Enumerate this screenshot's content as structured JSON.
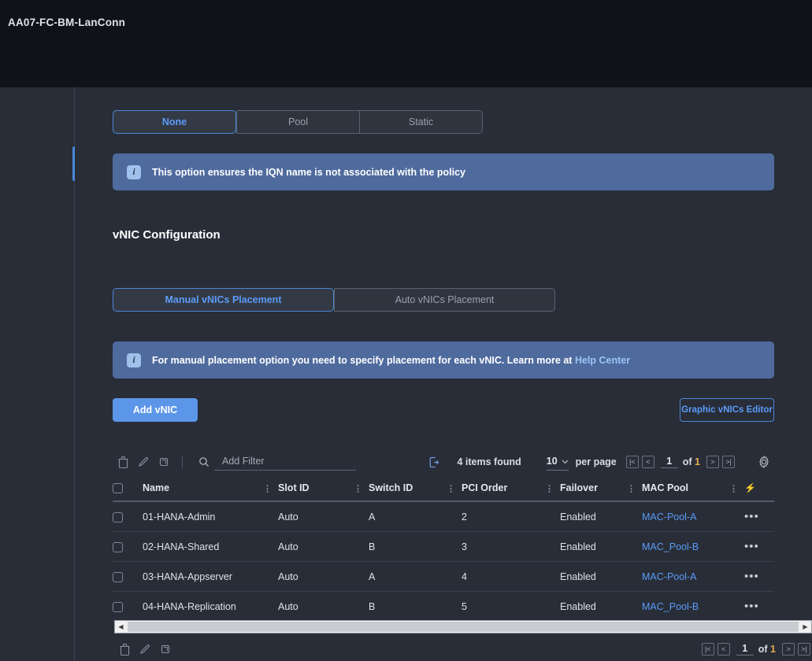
{
  "window": {
    "title": "AA07-FC-BM-LanConn"
  },
  "iqn_section": {
    "options": [
      {
        "label": "None",
        "active": true
      },
      {
        "label": "Pool",
        "active": false
      },
      {
        "label": "Static",
        "active": false
      }
    ],
    "banner": {
      "icon": "info-icon",
      "text": "This option ensures the IQN name is not associated with the policy"
    }
  },
  "vnic_section": {
    "heading": "vNIC Configuration",
    "placement_options": [
      {
        "label": "Manual vNICs Placement",
        "active": true
      },
      {
        "label": "Auto vNICs Placement",
        "active": false
      }
    ],
    "banner": {
      "icon": "info-icon",
      "text": "For manual placement option you need to specify placement for each vNIC. Learn more at ",
      "link": "Help Center"
    },
    "add_button": "Add vNIC",
    "graphic_editor_button": "Graphic vNICs Editor"
  },
  "toolbar": {
    "delete_icon": "trash-icon",
    "edit_icon": "pencil-icon",
    "clone_icon": "clone-icon",
    "search_icon": "search-icon",
    "filter_placeholder": "Add Filter",
    "filter_value": "",
    "refresh_icon": "refresh-icon",
    "items_found": "4 items found",
    "per_page_value": "10",
    "per_page_label": "per page",
    "page_number": "1",
    "page_total_prefix": "of ",
    "page_total": "1",
    "settings_icon": "gear-icon",
    "first_page_icon": "|<",
    "prev_page_icon": "<",
    "next_page_icon": ">",
    "last_page_icon": ">|"
  },
  "table": {
    "columns": [
      "Name",
      "Slot ID",
      "Switch ID",
      "PCI Order",
      "Failover",
      "MAC Pool"
    ],
    "sort_glyph": "⋮",
    "lightning_icon": "bolt-icon",
    "rows": [
      {
        "name": "01-HANA-Admin",
        "slot_id": "Auto",
        "switch_id": "A",
        "pci_order": "2",
        "failover": "Enabled",
        "mac_pool": "MAC-Pool-A",
        "menu": "•••"
      },
      {
        "name": "02-HANA-Shared",
        "slot_id": "Auto",
        "switch_id": "B",
        "pci_order": "3",
        "failover": "Enabled",
        "mac_pool": "MAC_Pool-B",
        "menu": "•••"
      },
      {
        "name": "03-HANA-Appserver",
        "slot_id": "Auto",
        "switch_id": "A",
        "pci_order": "4",
        "failover": "Enabled",
        "mac_pool": "MAC-Pool-A",
        "menu": "•••"
      },
      {
        "name": "04-HANA-Replication",
        "slot_id": "Auto",
        "switch_id": "B",
        "pci_order": "5",
        "failover": "Enabled",
        "mac_pool": "MAC_Pool-B",
        "menu": "•••"
      }
    ]
  },
  "footer": {
    "delete_icon": "trash-icon",
    "edit_icon": "pencil-icon",
    "clone_icon": "clone-icon",
    "page_number": "1",
    "page_total_prefix": "of ",
    "page_total": "1",
    "first_page_icon": "|<",
    "prev_page_icon": "<",
    "next_page_icon": ">",
    "last_page_icon": ">|"
  },
  "colors": {
    "accent_blue": "#5b9bf8",
    "banner_blue": "#4f6b9e",
    "button_blue": "#5b96e8",
    "page_bg": "#282d37",
    "topbar_bg": "#0f1318",
    "amber": "#e8ac54"
  }
}
